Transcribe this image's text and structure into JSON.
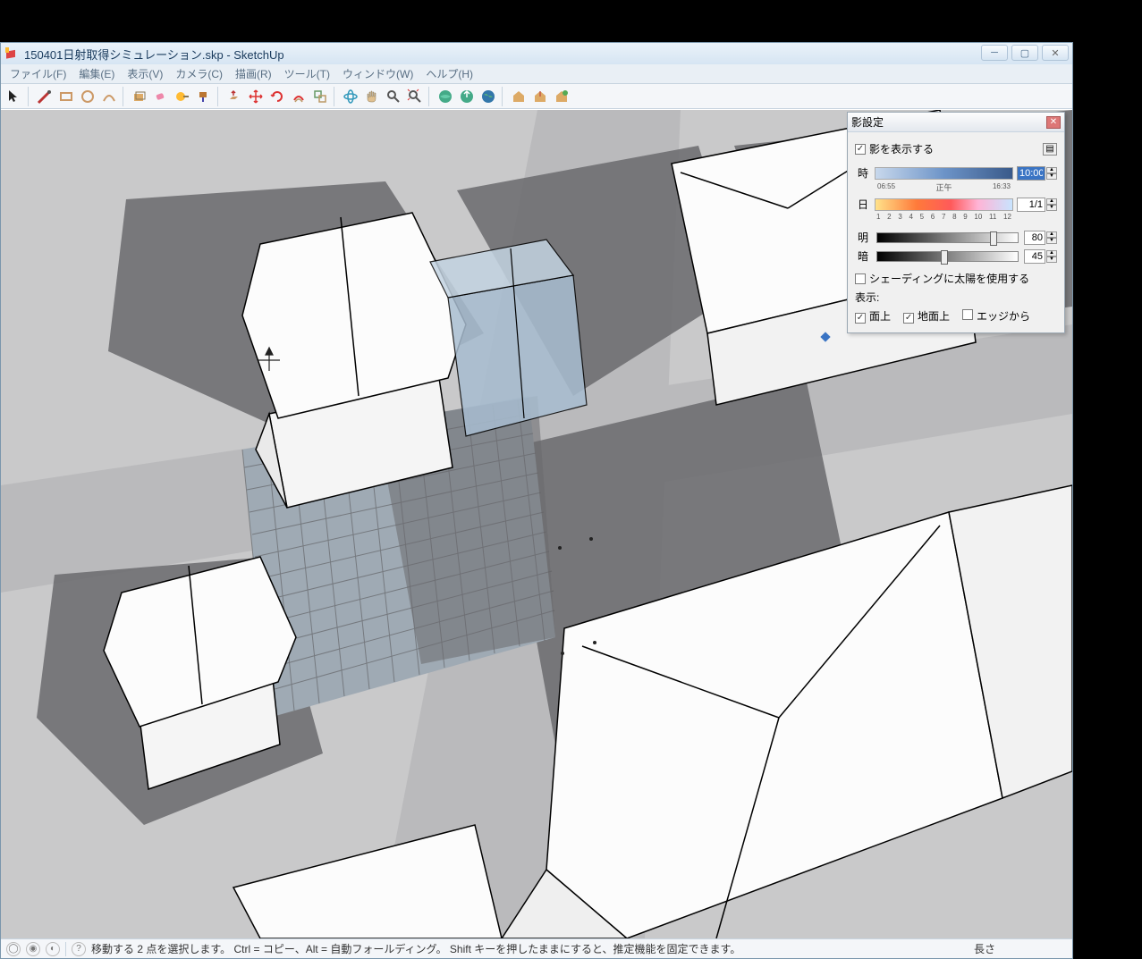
{
  "window": {
    "title": "150401日射取得シミュレーション.skp - SketchUp"
  },
  "menu": {
    "file": "ファイル(F)",
    "edit": "編集(E)",
    "view": "表示(V)",
    "camera": "カメラ(C)",
    "draw": "描画(R)",
    "tools": "ツール(T)",
    "window": "ウィンドウ(W)",
    "help": "ヘルプ(H)"
  },
  "shadow_dialog": {
    "title": "影設定",
    "show_shadows": "影を表示する",
    "time_label": "時",
    "time_start": "06:55",
    "time_noon": "正午",
    "time_end": "16:33",
    "time_value": "10:00",
    "date_label": "日",
    "date_months": [
      "1",
      "2",
      "3",
      "4",
      "5",
      "6",
      "7",
      "8",
      "9",
      "10",
      "11",
      "12"
    ],
    "date_value": "1/1",
    "light_label": "明",
    "light_value": "80",
    "dark_label": "暗",
    "dark_value": "45",
    "use_sun": "シェーディングに太陽を使用する",
    "display_label": "表示:",
    "on_faces": "面上",
    "on_ground": "地面上",
    "from_edges": "エッジから"
  },
  "status": {
    "hint": "移動する 2 点を選択します。 Ctrl = コピー、Alt = 自動フォールディング。 Shift キーを押したままにすると、推定機能を固定できます。",
    "measure_label": "長さ"
  },
  "colors": {
    "bg": "#c9c9ca",
    "shadow": "#6a6a6d",
    "face_white": "#fdfdfd",
    "face_blue": "#a8bdd0"
  }
}
